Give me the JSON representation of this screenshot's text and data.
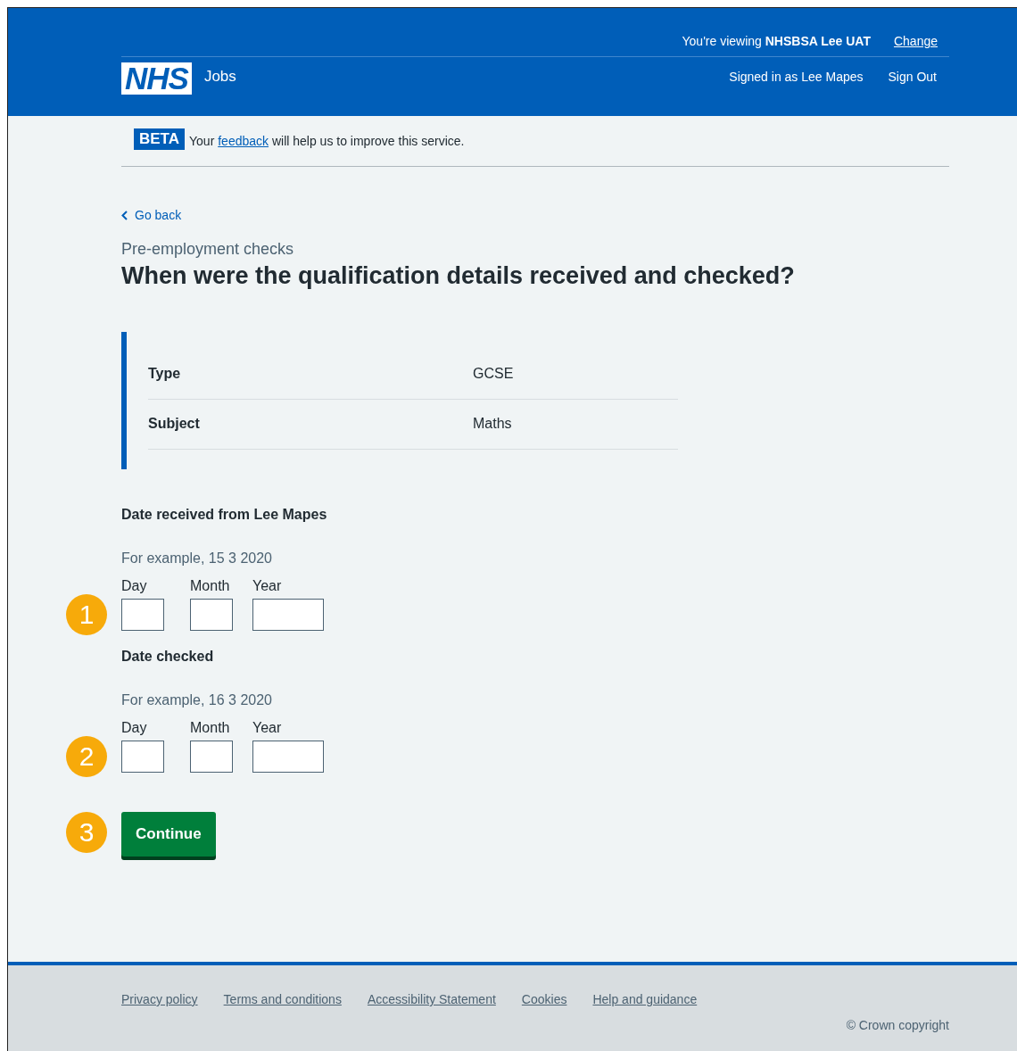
{
  "header": {
    "logo": "NHS",
    "product": "Jobs",
    "viewing": "You're viewing **NHSBSA Lee UAT**",
    "change_link": "Change",
    "signed_in": "Signed in as Lee Mapes",
    "sign_out": "Sign Out"
  },
  "phase_banner": {
    "tag": "BETA",
    "text_before": "Your ",
    "link": "feedback",
    "text_after": " will help us to improve this service."
  },
  "back_link": "Go back",
  "caption": "Pre-employment checks",
  "title": "When were the qualification details received and checked?",
  "summary": [
    {
      "key": "Type",
      "value": "GCSE"
    },
    {
      "key": "Subject",
      "value": "Maths"
    }
  ],
  "date_groups": [
    {
      "legend": "Date received from Lee Mapes",
      "hint": "For example, 15 3 2020",
      "marker": "1",
      "fields": [
        {
          "label": "Day"
        },
        {
          "label": "Month"
        },
        {
          "label": "Year"
        }
      ]
    },
    {
      "legend": "Date checked",
      "hint": "For example, 16 3 2020",
      "marker": "2",
      "fields": [
        {
          "label": "Day"
        },
        {
          "label": "Month"
        },
        {
          "label": "Year"
        }
      ]
    }
  ],
  "continue_button": {
    "label": "Continue",
    "marker": "3"
  },
  "footer": {
    "links": [
      "Privacy policy",
      "Terms and conditions",
      "Accessibility Statement",
      "Cookies",
      "Help and guidance"
    ],
    "copyright": "© Crown copyright"
  }
}
